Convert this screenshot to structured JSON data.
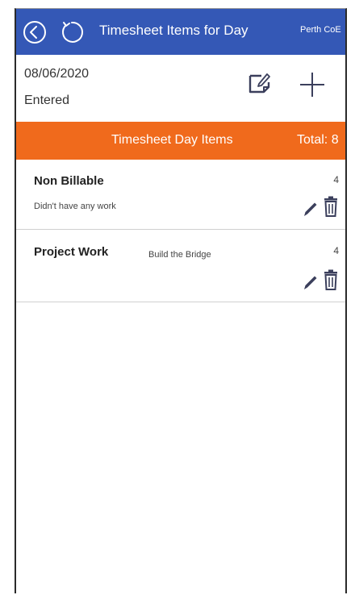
{
  "header": {
    "title": "Timesheet Items for Day",
    "org": "Perth CoE",
    "background": "#3458b6"
  },
  "summary": {
    "date": "08/06/2020",
    "status": "Entered"
  },
  "section": {
    "title": "Timesheet Day Items",
    "total": "Total: 8",
    "background": "#f06a1c"
  },
  "items": [
    {
      "name": "Non Billable",
      "description": "Didn't have any work",
      "hours": "4"
    },
    {
      "name": "Project Work",
      "description": "Build the Bridge",
      "hours": "4"
    }
  ],
  "icons": {
    "back": "back-arrow-circle-icon",
    "refresh": "refresh-icon",
    "edit_day": "edit-note-icon",
    "add": "plus-icon",
    "edit_item": "pencil-icon",
    "delete_item": "trash-icon"
  },
  "colors": {
    "accent_blue": "#3458b6",
    "accent_orange": "#f06a1c",
    "icon_dark": "#3b3f5c"
  }
}
